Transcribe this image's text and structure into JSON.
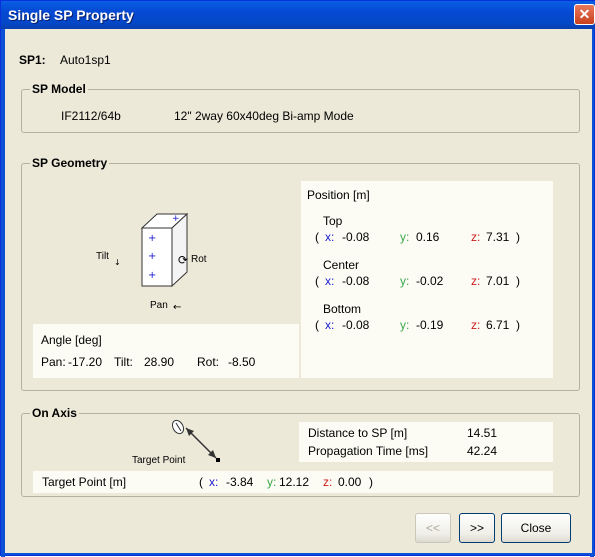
{
  "window": {
    "title": "Single SP Property",
    "close_glyph": "✕"
  },
  "sp": {
    "label": "SP1:",
    "name": "Auto1sp1"
  },
  "model": {
    "group_title": "SP Model",
    "model_number": "IF2112/64b",
    "description": "12\" 2way 60x40deg Bi-amp Mode"
  },
  "geometry": {
    "group_title": "SP Geometry",
    "diagram": {
      "tilt_label": "Tilt",
      "rot_label": "Rot",
      "pan_label": "Pan"
    },
    "angle": {
      "header": "Angle [deg]",
      "pan_label": "Pan:",
      "pan_value": "-17.20",
      "tilt_label": "Tilt:",
      "tilt_value": "28.90",
      "rot_label": "Rot:",
      "rot_value": "-8.50"
    },
    "position": {
      "header": "Position [m]",
      "points": [
        {
          "name": "Top",
          "x": "-0.08",
          "y": "0.16",
          "z": "7.31"
        },
        {
          "name": "Center",
          "x": "-0.08",
          "y": "-0.02",
          "z": "7.01"
        },
        {
          "name": "Bottom",
          "x": "-0.08",
          "y": "-0.19",
          "z": "6.71"
        }
      ],
      "x_label": "x:",
      "y_label": "y:",
      "z_label": "z:",
      "open_paren": "(",
      "close_paren": ")"
    }
  },
  "on_axis": {
    "group_title": "On Axis",
    "target_point_caption": "Target Point",
    "distance_label": "Distance to SP [m]",
    "distance_value": "14.51",
    "propagation_label": "Propagation Time  [ms]",
    "propagation_value": "42.24",
    "target_label": "Target Point [m]",
    "target": {
      "x": "-3.84",
      "y": "12.12",
      "z": "0.00"
    }
  },
  "buttons": {
    "prev": "<<",
    "next": ">>",
    "close": "Close"
  },
  "colors": {
    "x": "#1a1ad0",
    "y": "#3aa84a",
    "z": "#d01a1a",
    "titlebar": "#0549d4"
  }
}
